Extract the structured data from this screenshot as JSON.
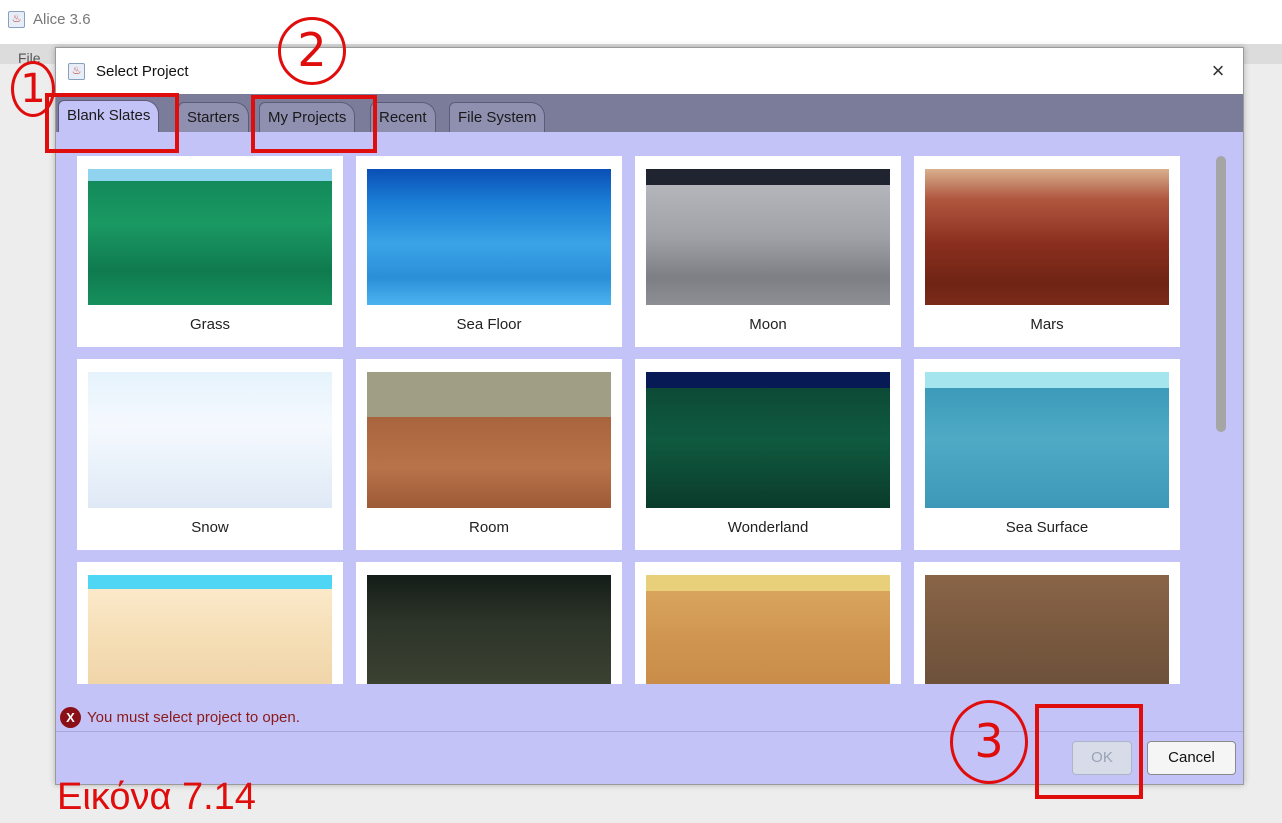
{
  "background_window": {
    "title": "Alice 3.6",
    "menu_fragment": "File"
  },
  "dialog": {
    "title": "Select Project",
    "close_glyph": "×",
    "tabs": [
      {
        "label": "Blank Slates",
        "active": true
      },
      {
        "label": "Starters",
        "active": false
      },
      {
        "label": "My Projects",
        "active": false
      },
      {
        "label": "Recent",
        "active": false
      },
      {
        "label": "File System",
        "active": false
      }
    ],
    "templates": [
      {
        "label": "Grass"
      },
      {
        "label": "Sea Floor"
      },
      {
        "label": "Moon"
      },
      {
        "label": "Mars"
      },
      {
        "label": "Snow"
      },
      {
        "label": "Room"
      },
      {
        "label": "Wonderland"
      },
      {
        "label": "Sea Surface"
      },
      {
        "label": ""
      },
      {
        "label": ""
      },
      {
        "label": ""
      },
      {
        "label": ""
      }
    ],
    "status_message": "You must select project to open.",
    "status_icon": "error-icon",
    "ok_label": "OK",
    "cancel_label": "Cancel"
  },
  "annotations": {
    "markers": [
      "1",
      "2",
      "3"
    ],
    "caption": "Εικόνα 7.14",
    "color": "#e00d0d"
  }
}
